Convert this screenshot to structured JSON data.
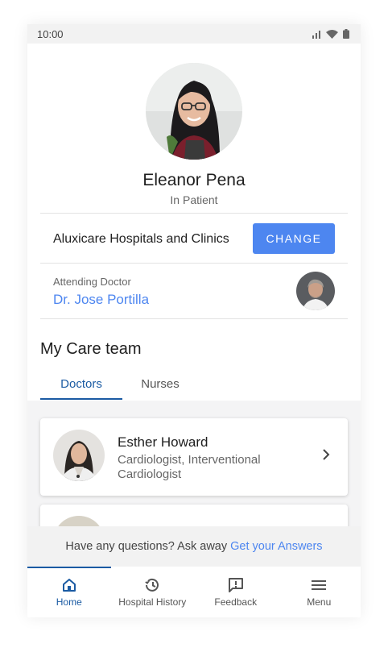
{
  "status_bar": {
    "time": "10:00"
  },
  "patient": {
    "name": "Eleanor Pena",
    "status": "In Patient"
  },
  "hospital": {
    "name": "Aluxicare Hospitals and Clinics",
    "change_label": "CHANGE"
  },
  "attending": {
    "label": "Attending Doctor",
    "doctor": "Dr. Jose Portilla"
  },
  "care_team": {
    "title": "My Care team",
    "tabs": [
      {
        "label": "Doctors",
        "active": true
      },
      {
        "label": "Nurses",
        "active": false
      }
    ],
    "doctors": [
      {
        "name": "Esther Howard",
        "role": "Cardiologist, Interventional Cardiologist"
      }
    ]
  },
  "ask_bar": {
    "text": "Have any questions? Ask away",
    "link": "Get your Answers"
  },
  "bottom_nav": [
    {
      "label": "Home",
      "icon": "home-icon",
      "active": true
    },
    {
      "label": "Hospital History",
      "icon": "history-icon",
      "active": false
    },
    {
      "label": "Feedback",
      "icon": "feedback-icon",
      "active": false
    },
    {
      "label": "Menu",
      "icon": "menu-icon",
      "active": false
    }
  ],
  "colors": {
    "accent": "#4d86f0",
    "nav_active": "#1b5ba3"
  }
}
